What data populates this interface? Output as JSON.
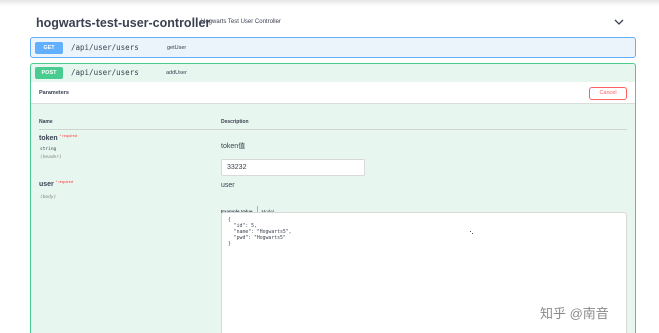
{
  "section": {
    "title": "hogwarts-test-user-controller",
    "description": "Hogwarts Test User Controller"
  },
  "get_op": {
    "method": "GET",
    "path": "/api/user/users",
    "summary": "getUser"
  },
  "post_op": {
    "method": "POST",
    "path": "/api/user/users",
    "summary": "addUser",
    "parameters_title": "Parameters",
    "cancel_label": "Cancel",
    "columns": {
      "name": "Name",
      "description": "Description"
    },
    "params": [
      {
        "name": "token",
        "required": "* required",
        "type": "string",
        "in": "(header)",
        "description": "token值",
        "value": "33232"
      },
      {
        "name": "user",
        "required": "* required",
        "in": "(body)",
        "description": "user"
      }
    ],
    "tabs": {
      "example": "Example Value",
      "model": "Model"
    },
    "body_json": "{\n  \"id\": 5,\n  \"name\": \"Hogwarts5\",\n  \"pwd\": \"Hogwarts5\"\n}"
  },
  "watermark": "知乎 @南音",
  "icons": {
    "collapse": "chevron-down-icon"
  },
  "colors": {
    "get": "#61affe",
    "post": "#49cc90",
    "cancel": "#ff6060"
  }
}
